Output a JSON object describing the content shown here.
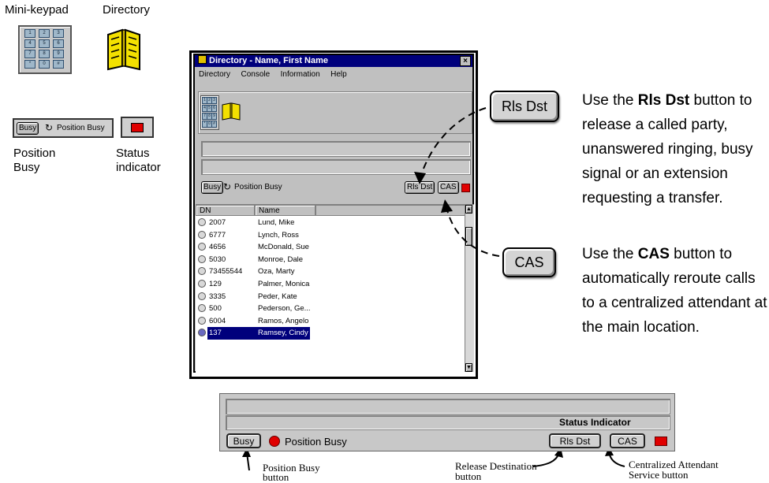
{
  "top_legend": {
    "minikeypad_label": "Mini-keypad",
    "directory_label": "Directory",
    "position_busy_label_1": "Position",
    "position_busy_label_2": "Busy",
    "status_label_1": "Status",
    "status_label_2": "indicator",
    "busy_btn": "Busy",
    "position_busy_text": "Position Busy",
    "keypad_keys": [
      "1",
      "2",
      "3",
      "4",
      "5",
      "6",
      "7",
      "8",
      "9",
      "*",
      "0",
      "#"
    ]
  },
  "window": {
    "title": "Directory - Name, First Name",
    "close_glyph": "×",
    "menu": [
      "Directory",
      "Console",
      "Information",
      "Help"
    ],
    "busy_btn": "Busy",
    "position_busy_text": "Position Busy",
    "rls_dst_btn": "Rls Dst",
    "cas_btn": "CAS",
    "columns": [
      "DN",
      "Name"
    ],
    "rows": [
      {
        "dn": "2007",
        "name": "Lund, Mike"
      },
      {
        "dn": "6777",
        "name": "Lynch, Ross"
      },
      {
        "dn": "4656",
        "name": "McDonald, Sue"
      },
      {
        "dn": "5030",
        "name": "Monroe, Dale"
      },
      {
        "dn": "73455544",
        "name": "Oza, Marty"
      },
      {
        "dn": "129",
        "name": "Palmer, Monica"
      },
      {
        "dn": "3335",
        "name": "Peder, Kate"
      },
      {
        "dn": "500",
        "name": "Pederson, Ge..."
      },
      {
        "dn": "6004",
        "name": "Ramos, Angelo"
      },
      {
        "dn": "137",
        "name": "Ramsey, Cindy"
      }
    ],
    "selected_row": 9
  },
  "callouts": {
    "rls_btn": "Rls Dst",
    "cas_btn": "CAS",
    "rls_text": [
      {
        "pre": "Use the ",
        "bold": "Rls Dst",
        "post": " button to"
      },
      {
        "pre": "release a called party,",
        "bold": "",
        "post": ""
      },
      {
        "pre": "unanswered ringing, busy",
        "bold": "",
        "post": ""
      },
      {
        "pre": "signal or an extension",
        "bold": "",
        "post": ""
      },
      {
        "pre": "requesting a transfer.",
        "bold": "",
        "post": ""
      }
    ],
    "cas_text": [
      {
        "pre": "Use the ",
        "bold": "CAS",
        "post": " button to"
      },
      {
        "pre": "automatically reroute calls",
        "bold": "",
        "post": ""
      },
      {
        "pre": "to a centralized attendant at",
        "bold": "",
        "post": ""
      },
      {
        "pre": "the main location.",
        "bold": "",
        "post": ""
      }
    ]
  },
  "bottom_panel": {
    "status_indicator_label": "Status Indicator",
    "busy_btn": "Busy",
    "position_busy_text": "Position Busy",
    "rls_dst_btn": "Rls Dst",
    "cas_btn": "CAS",
    "caption_busy_1": "Position Busy",
    "caption_busy_2": "button",
    "caption_rls_1": "Release Destination",
    "caption_rls_2": "button",
    "caption_cas_1": "Centralized Attendant",
    "caption_cas_2": "Service button"
  },
  "colors": {
    "title_bar": "#00007c",
    "status_red": "#e00000",
    "selected_row": "#00007c"
  }
}
